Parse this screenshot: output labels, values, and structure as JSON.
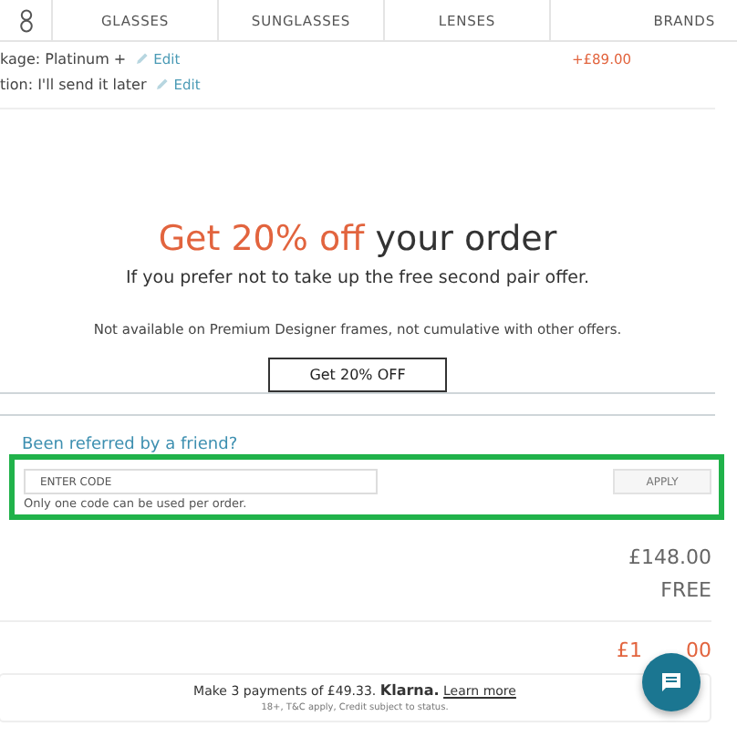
{
  "nav": {
    "items": [
      {
        "label": "GLASSES"
      },
      {
        "label": "SUNGLASSES"
      },
      {
        "label": "LENSES"
      },
      {
        "label": "BRANDS"
      }
    ]
  },
  "options": [
    {
      "label": "kage: Platinum +",
      "edit": "Edit",
      "price": "+£89.00"
    },
    {
      "label": "tion: I'll send it later",
      "edit": "Edit"
    }
  ],
  "offer": {
    "highlight": "Get 20% off",
    "title_rest": "your order",
    "subtitle": "If you prefer not to take up the free second pair offer.",
    "note": "Not available on Premium Designer frames, not cumulative with other offers.",
    "button": "Get 20% OFF"
  },
  "referral": {
    "link": "Been referred by a friend?",
    "placeholder": "ENTER CODE",
    "apply": "APPLY",
    "hint": "Only one code can be used per order."
  },
  "totals": {
    "subtotal": "£148.00",
    "delivery": "FREE",
    "total_visible_start": "£1",
    "total_visible_end": "00"
  },
  "klarna": {
    "line": "Make 3 payments of £49.33. **Klarna.**",
    "link": "Learn more",
    "small": "18+, T&C apply, Credit subject to status."
  }
}
